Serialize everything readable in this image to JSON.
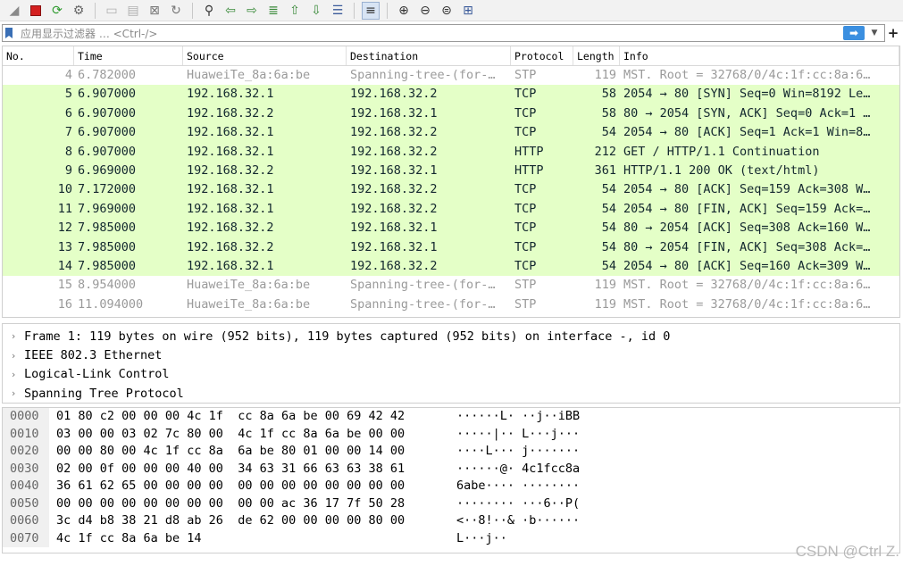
{
  "filter": {
    "placeholder": "应用显示过滤器 … <Ctrl-/>"
  },
  "columns": [
    "No.",
    "Time",
    "Source",
    "Destination",
    "Protocol",
    "Length",
    "Info"
  ],
  "packets": [
    {
      "no": "4",
      "time": "6.782000",
      "src": "HuaweiTe_8a:6a:be",
      "dst": "Spanning-tree-(for-…",
      "proto": "STP",
      "len": "119",
      "info": "MST. Root = 32768/0/4c:1f:cc:8a:6…"
    },
    {
      "no": "5",
      "time": "6.907000",
      "src": "192.168.32.1",
      "dst": "192.168.32.2",
      "proto": "TCP",
      "len": "58",
      "info": "2054 → 80 [SYN] Seq=0 Win=8192 Le…"
    },
    {
      "no": "6",
      "time": "6.907000",
      "src": "192.168.32.2",
      "dst": "192.168.32.1",
      "proto": "TCP",
      "len": "58",
      "info": "80 → 2054 [SYN, ACK] Seq=0 Ack=1 …"
    },
    {
      "no": "7",
      "time": "6.907000",
      "src": "192.168.32.1",
      "dst": "192.168.32.2",
      "proto": "TCP",
      "len": "54",
      "info": "2054 → 80 [ACK] Seq=1 Ack=1 Win=8…"
    },
    {
      "no": "8",
      "time": "6.907000",
      "src": "192.168.32.1",
      "dst": "192.168.32.2",
      "proto": "HTTP",
      "len": "212",
      "info": "GET / HTTP/1.1 Continuation"
    },
    {
      "no": "9",
      "time": "6.969000",
      "src": "192.168.32.2",
      "dst": "192.168.32.1",
      "proto": "HTTP",
      "len": "361",
      "info": "HTTP/1.1 200 OK  (text/html)"
    },
    {
      "no": "10",
      "time": "7.172000",
      "src": "192.168.32.1",
      "dst": "192.168.32.2",
      "proto": "TCP",
      "len": "54",
      "info": "2054 → 80 [ACK] Seq=159 Ack=308 W…"
    },
    {
      "no": "11",
      "time": "7.969000",
      "src": "192.168.32.1",
      "dst": "192.168.32.2",
      "proto": "TCP",
      "len": "54",
      "info": "2054 → 80 [FIN, ACK] Seq=159 Ack=…"
    },
    {
      "no": "12",
      "time": "7.985000",
      "src": "192.168.32.2",
      "dst": "192.168.32.1",
      "proto": "TCP",
      "len": "54",
      "info": "80 → 2054 [ACK] Seq=308 Ack=160 W…"
    },
    {
      "no": "13",
      "time": "7.985000",
      "src": "192.168.32.2",
      "dst": "192.168.32.1",
      "proto": "TCP",
      "len": "54",
      "info": "80 → 2054 [FIN, ACK] Seq=308 Ack=…"
    },
    {
      "no": "14",
      "time": "7.985000",
      "src": "192.168.32.1",
      "dst": "192.168.32.2",
      "proto": "TCP",
      "len": "54",
      "info": "2054 → 80 [ACK] Seq=160 Ack=309 W…"
    },
    {
      "no": "15",
      "time": "8.954000",
      "src": "HuaweiTe_8a:6a:be",
      "dst": "Spanning-tree-(for-…",
      "proto": "STP",
      "len": "119",
      "info": "MST. Root = 32768/0/4c:1f:cc:8a:6…"
    },
    {
      "no": "16",
      "time": "11.094000",
      "src": "HuaweiTe_8a:6a:be",
      "dst": "Spanning-tree-(for-…",
      "proto": "STP",
      "len": "119",
      "info": "MST. Root = 32768/0/4c:1f:cc:8a:6…"
    }
  ],
  "details": [
    "Frame 1: 119 bytes on wire (952 bits), 119 bytes captured (952 bits) on interface -, id 0",
    "IEEE 802.3 Ethernet",
    "Logical-Link Control",
    "Spanning Tree Protocol"
  ],
  "bytes": [
    {
      "off": "0000",
      "hex": "01 80 c2 00 00 00 4c 1f  cc 8a 6a be 00 69 42 42",
      "ascii": "······L· ··j··iBB"
    },
    {
      "off": "0010",
      "hex": "03 00 00 03 02 7c 80 00  4c 1f cc 8a 6a be 00 00",
      "ascii": "·····|·· L···j···"
    },
    {
      "off": "0020",
      "hex": "00 00 80 00 4c 1f cc 8a  6a be 80 01 00 00 14 00",
      "ascii": "····L··· j·······"
    },
    {
      "off": "0030",
      "hex": "02 00 0f 00 00 00 40 00  34 63 31 66 63 63 38 61",
      "ascii": "······@· 4c1fcc8a"
    },
    {
      "off": "0040",
      "hex": "36 61 62 65 00 00 00 00  00 00 00 00 00 00 00 00",
      "ascii": "6abe···· ········"
    },
    {
      "off": "0050",
      "hex": "00 00 00 00 00 00 00 00  00 00 ac 36 17 7f 50 28",
      "ascii": "········ ···6··P("
    },
    {
      "off": "0060",
      "hex": "3c d4 b8 38 21 d8 ab 26  de 62 00 00 00 00 80 00",
      "ascii": "<··8!··& ·b······"
    },
    {
      "off": "0070",
      "hex": "4c 1f cc 8a 6a be 14",
      "ascii": "L···j··"
    }
  ],
  "watermark": "CSDN @Ctrl Z.",
  "colors": {
    "tcp_http_row": "#e4ffc7",
    "stp_text": "#9a9a9a",
    "apply_button": "#3b8fe0"
  },
  "icons": [
    "shark-fin-icon",
    "stop-icon",
    "restart-icon",
    "options-icon",
    "open-icon",
    "save-icon",
    "close-file-icon",
    "reload-icon",
    "find-icon",
    "back-icon",
    "forward-icon",
    "goto-icon",
    "first-icon",
    "last-icon",
    "autoscroll-icon",
    "colorize-icon",
    "zoom-in-icon",
    "zoom-out-icon",
    "zoom-reset-icon",
    "resize-columns-icon"
  ]
}
